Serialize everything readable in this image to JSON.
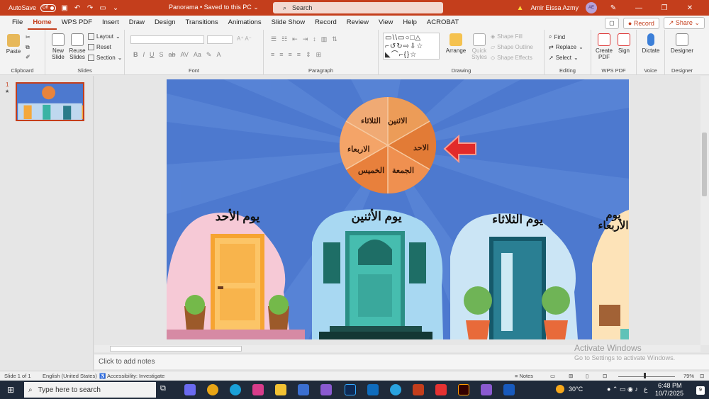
{
  "titlebar": {
    "autosave": "AutoSave",
    "autosave_state": "Off",
    "doc_title": "Panorama • Saved to this PC ⌄",
    "search": "Search",
    "user": "Amir Eissa Azmy",
    "initials": "AE"
  },
  "menu": {
    "tabs": [
      "File",
      "Home",
      "WPS PDF",
      "Insert",
      "Draw",
      "Design",
      "Transitions",
      "Animations",
      "Slide Show",
      "Record",
      "Review",
      "View",
      "Help",
      "ACROBAT"
    ],
    "record": "Record",
    "share": "Share"
  },
  "ribbon": {
    "clipboard": {
      "label": "Clipboard",
      "paste": "Paste"
    },
    "slides": {
      "label": "Slides",
      "new_slide": "New Slide",
      "reuse": "Reuse Slides",
      "layout": "Layout",
      "reset": "Reset",
      "section": "Section"
    },
    "font": {
      "label": "Font"
    },
    "paragraph": {
      "label": "Paragraph"
    },
    "drawing": {
      "label": "Drawing",
      "arrange": "Arrange",
      "quick_styles": "Quick Styles",
      "shape_fill": "Shape Fill",
      "shape_outline": "Shape Outline",
      "shape_effects": "Shape Effects"
    },
    "editing": {
      "label": "Editing",
      "find": "Find",
      "replace": "Replace",
      "select": "Select"
    },
    "wps": {
      "label": "WPS PDF",
      "create": "Create PDF",
      "sign": "Sign"
    },
    "voice": {
      "label": "Voice",
      "dictate": "Dictate"
    },
    "designer": {
      "label": "Designer",
      "designer": "Designer"
    }
  },
  "thumbnail": {
    "number": "1",
    "star": "★"
  },
  "slide": {
    "wheel": [
      "الاثنين",
      "الاحد",
      "الجمعة",
      "الخميس",
      "الاربعاء",
      "الثلاثاء"
    ],
    "doors": [
      "يوم الأحد",
      "يوم الأثنين",
      "يوم الثلاثاء",
      "يوم الأربعاء"
    ]
  },
  "notes": {
    "placeholder": "Click to add notes"
  },
  "watermark": {
    "line1": "Activate Windows",
    "line2": "Go to Settings to activate Windows."
  },
  "status": {
    "slide": "Slide 1 of 1",
    "language": "English (United States)",
    "accessibility": "Accessibility: Investigate",
    "notes": "Notes",
    "zoom": "79%"
  },
  "taskbar": {
    "search": "Type here to search",
    "weather": "30°C",
    "lang": "ع",
    "time": "6:48 PM",
    "date": "10/7/2025",
    "notif_count": "9"
  }
}
